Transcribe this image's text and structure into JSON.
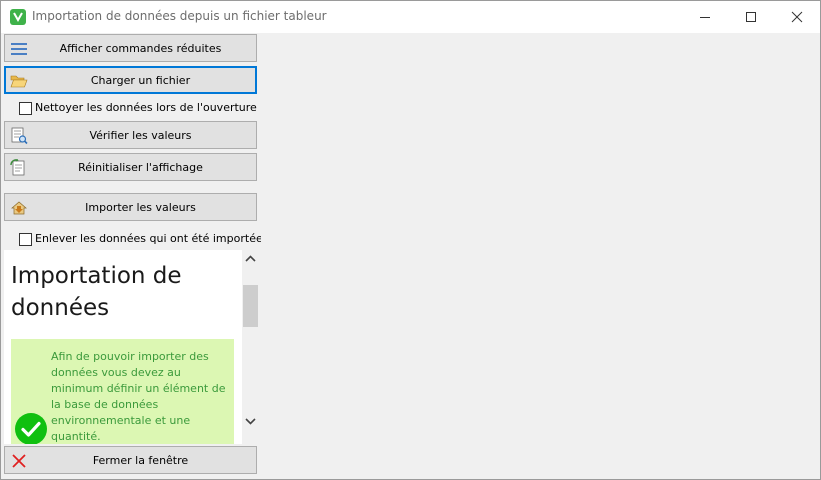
{
  "window": {
    "title": "Importation de données depuis un fichier tableur"
  },
  "commands": {
    "show_reduced": "Afficher commandes réduites",
    "load_file": "Charger un fichier",
    "clean_on_open": "Nettoyer les données lors de l'ouverture",
    "verify_values": "Vérifier les valeurs",
    "reset_display": "Réinitialiser l'affichage",
    "import_values": "Importer les valeurs",
    "remove_imported": "Enlever les données qui ont été importées",
    "close_window": "Fermer la fenêtre"
  },
  "checkboxes": {
    "clean_on_open_checked": false,
    "remove_imported_checked": false
  },
  "help": {
    "title": "Importation de données",
    "notice": "Afin de pouvoir importer des données vous devez au minimum définir un élément de la base de données environnementale et une quantité."
  },
  "colors": {
    "focus": "#0078d7",
    "notice_bg": "#dcf7b3",
    "notice_text": "#3b9a3b",
    "check_green": "#10c010",
    "close_red": "#e02020"
  },
  "icons": {
    "menu": "menu-lines-icon",
    "folder": "open-folder-icon",
    "verify": "verify-document-icon",
    "reset": "reset-document-icon",
    "import": "import-icon",
    "close": "red-x-icon",
    "notice": "green-check-circle-icon"
  }
}
